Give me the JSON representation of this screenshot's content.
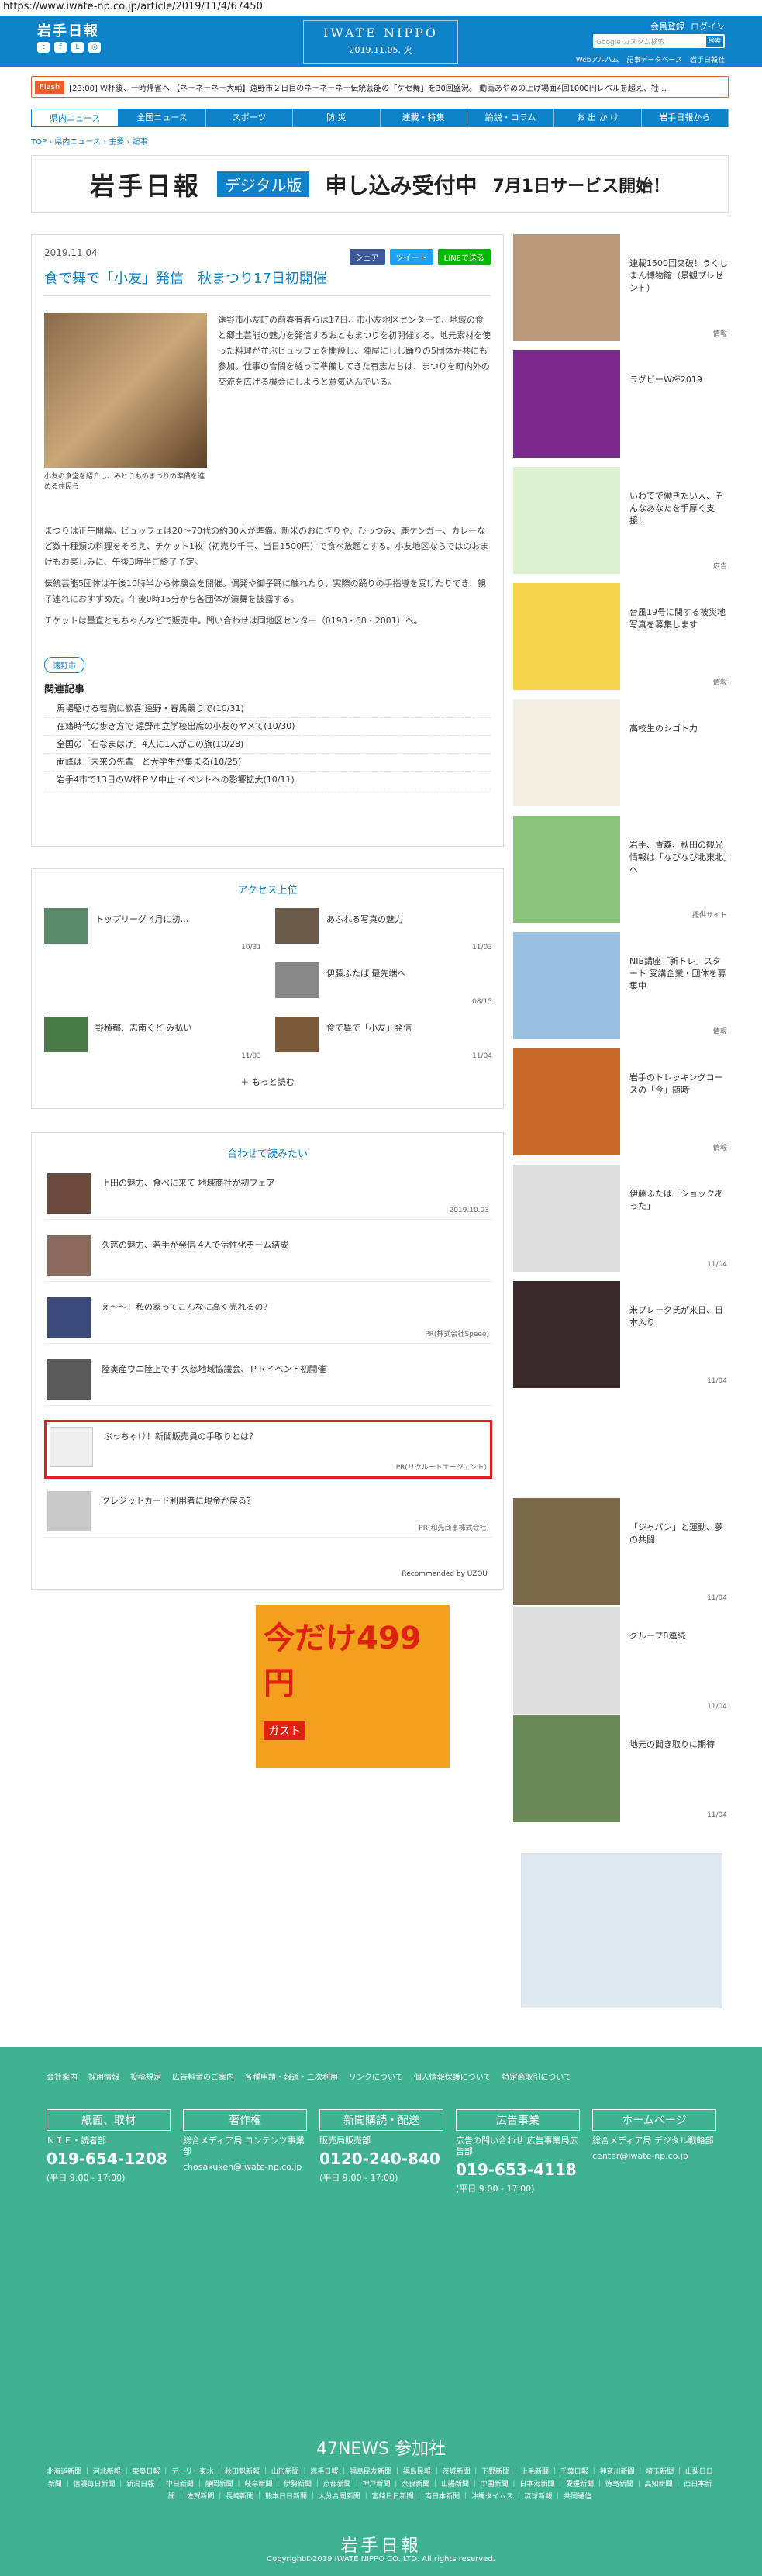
{
  "url": "https://www.iwate-np.co.jp/article/2019/11/4/67450",
  "header": {
    "logo": "岩手日報",
    "center_title": "IWATE NIPPO",
    "center_date": "2019.11.05. 火",
    "links": [
      "会員登録",
      "ログイン"
    ],
    "search_placeholder": "Google カスタム検索",
    "search_btn": "検索",
    "sub_links": [
      "Webアルバム",
      "記事データベース",
      "岩手日報社"
    ]
  },
  "flash": {
    "label": "Flash",
    "text": "[23:00] Ｗ杯後、一時帰省へ  【ネーネーネー大輔】遠野市２日目のネーネーネー伝統芸能の「ケセ舞」を30回盛況。 動画あやめの上げ場面4回1000円レベルを超え、社…"
  },
  "nav": [
    "県内ニュース",
    "全国ニュース",
    "スポーツ",
    "防 災",
    "連載・特集",
    "論説・コラム",
    "お 出 か け",
    "岩手日報から"
  ],
  "breadcrumb": "TOP › 県内ニュース › 主要 › 記事",
  "banner": {
    "b1": "岩手日報",
    "b2": "デジタル版",
    "b3": "申し込み受付中",
    "b4": "7月1日サービス開始！"
  },
  "article": {
    "date": "2019.11.04",
    "share": [
      "シェア",
      "ツイート",
      "LINEで送る"
    ],
    "title": "食で舞で「小友」発信　秋まつり17日初開催",
    "caption": "小友の食堂を紹介し、みとうものまつりの準備を進める住民ら",
    "body": "遠野市小友町の前春有者らは17日、市小友地区センターで、地域の食と郷土芸能の魅力を発信するおともまつりを初開催する。地元素材を使った料理が並ぶビュッフェを開設し、陣屋にしし踊りの5団体が共にも参加。仕事の合間を縫って準備してきた有志たちは、まつりを町内外の交流を広げる機会にしようと意気込んでいる。",
    "body2": "まつりは正午開幕。ビュッフェは20〜70代の約30人が準備。新米のおにぎりや、ひっつみ、鹿ケンガー、カレーなど数十種類の料理をそろえ、チケット1枚（初売り千円、当日1500円）で食べ放題とする。小友地区ならではのおまけもお楽しみに、午後3時半ご終了予定。",
    "body3": "伝統芸能5団体は午後10時半から体験会を開催。偶発や御子踊に触れたり、実際の踊りの手指導を受けたりでき、親子連れにおすすめだ。午後0時15分から各団体が演舞を披露する。",
    "body4": "チケットは量直ともちゃんなどで販売中。問い合わせは同地区センター（0198・68・2001）へ。",
    "tag": "遠野市",
    "related_heading": "関連記事",
    "related": [
      "馬場駆ける若駒に歓喜 遠野・春馬競りで(10/31)",
      "在籍時代の歩き方で 遠野市立学校出席の小友のヤメて(10/30)",
      "全国の「石なまはげ」4人に1人がこの旗(10/28)",
      "両峰は「未来の先輩」と大学生が集まる(10/25)",
      "岩手4市で13日のＷ杯ＰＶ中止 イベントへの影響拡大(10/11)"
    ]
  },
  "access": {
    "title": "アクセス上位",
    "items": [
      {
        "title": "トップリーグ 4月に初…",
        "date": "10/31"
      },
      {
        "title": "あふれる写真の魅力",
        "date": "11/03"
      },
      {
        "title": "伊藤ふたば 最先端へ",
        "date": "08/15"
      },
      {
        "title": "野積都、志南くど み払い",
        "date": "11/03"
      },
      {
        "title": "食で舞で「小友」発信",
        "date": "11/04"
      }
    ],
    "more": "もっと読む"
  },
  "read": {
    "title": "合わせて読みたい",
    "items": [
      {
        "title": "上田の魅力、食べに来て 地域商社が初フェア",
        "date": "2019.10.03"
      },
      {
        "title": "久慈の魅力、若手が発信 4人で活性化チーム結成",
        "date": ""
      },
      {
        "title": "え〜〜！私の家ってこんなに高く売れるの？",
        "date": "PR(株式会社Speee)"
      },
      {
        "title": "陸奥産ウニ陸上です 久慈地域協議会、ＰＲイベント初開催",
        "date": ""
      },
      {
        "title": "ぶっちゃけ！新聞販売員の手取りとは？",
        "date": "PR(リクルートエージェント)"
      },
      {
        "title": "クレジットカード利用者に現金が戻る？",
        "date": "PR(和光商事株式会社)"
      }
    ],
    "powered": "Recommended by UZOU"
  },
  "gusto": {
    "price": "今だけ499円",
    "brand": "ガスト"
  },
  "side": [
    {
      "title": "連載1500回突破！うくしまん博物館（景観プレゼント）",
      "date": "情報"
    },
    {
      "title": "ラグビーW杯2019",
      "date": ""
    },
    {
      "title": "いわてで働きたい人、そんなあなたを手厚く支援！",
      "date": "広告"
    },
    {
      "title": "台風19号に関する被災地写真を募集します",
      "date": "情報"
    },
    {
      "title": "高校生のシゴト力",
      "date": ""
    },
    {
      "title": "岩手、青森、秋田の観光情報は「なびなび北東北」へ",
      "date": "提供サイト"
    },
    {
      "title": "NIB講座「新トレ」スタート 受講企業・団体を募集中",
      "date": "情報"
    },
    {
      "title": "岩手のトレッキングコースの「今」随時",
      "date": "情報"
    },
    {
      "title": "伊藤ふたば「ショックあった」",
      "date": "11/04"
    },
    {
      "title": "米プレーク氏が来日、日本入り",
      "date": "11/04"
    }
  ],
  "side2": [
    {
      "title": "「ジャパン」と運動、夢の共闘",
      "date": "11/04"
    },
    {
      "title": "グループ8連続",
      "date": "11/04"
    },
    {
      "title": "地元の聞き取りに期待",
      "date": "11/04"
    }
  ],
  "footer": {
    "nav": [
      "会社案内",
      "採用情報",
      "投稿規定",
      "広告料金のご案内",
      "各種申請・報道・二次利用",
      "リンクについて",
      "個人情報保護について",
      "特定商取引について"
    ],
    "cols": [
      {
        "h": "紙面、取材",
        "l": "ＮＩＥ・読者部",
        "p": "019-654-1208",
        "m": "(平日 9:00 - 17:00)"
      },
      {
        "h": "著作権",
        "l": "総合メディア局 コンテンツ事業部",
        "p": "",
        "m": "chosakuken@iwate-np.co.jp"
      },
      {
        "h": "新聞購読・配送",
        "l": "販売局販売部",
        "p": "0120-240-840",
        "m": "(平日 9:00 - 17:00)"
      },
      {
        "h": "広告事業",
        "l": "広告の問い合わせ 広告事業局広告部",
        "p": "019-653-4118",
        "m": "(平日 9:00 - 17:00)"
      },
      {
        "h": "ホームページ",
        "l": "総合メディア局 デジタル戦略部",
        "p": "",
        "m": "center@iwate-np.co.jp"
      }
    ],
    "f47": "47NEWS 参加社",
    "f47list": "北海道新聞 ｜ 河北新報 ｜ 東奥日報 ｜ デーリー東北 ｜ 秋田魁新報 ｜ 山形新聞 ｜ 岩手日報 ｜ 福島民友新聞 ｜ 福島民報 ｜ 茨城新聞 ｜ 下野新聞 ｜ 上毛新聞 ｜ 千葉日報 ｜ 神奈川新聞 ｜ 埼玉新聞 ｜ 山梨日日新聞 ｜ 信濃毎日新聞 ｜ 新潟日報 ｜ 中日新聞 ｜ 静岡新聞 ｜ 岐阜新聞 ｜ 伊勢新聞 ｜ 京都新聞 ｜ 神戸新聞 ｜ 奈良新聞 ｜ 山陽新聞 ｜ 中国新聞 ｜ 日本海新聞 ｜ 愛媛新聞 ｜ 徳島新聞 ｜ 高知新聞 ｜ 西日本新聞 ｜ 佐賀新聞 ｜ 長崎新聞 ｜ 熊本日日新聞 ｜ 大分合同新聞 ｜ 宮崎日日新聞 ｜ 南日本新聞 ｜ 沖縄タイムス ｜ 琉球新報 ｜ 共同通信",
    "logo": "岩手日報",
    "copy": "Copyright©2019 IWATE NIPPO CO.,LTD. All rights reserved."
  }
}
